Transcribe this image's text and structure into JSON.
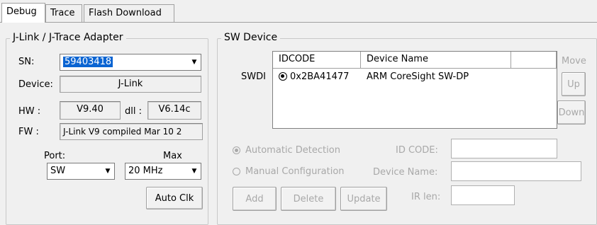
{
  "tabs": [
    "Debug",
    "Trace",
    "Flash Download"
  ],
  "adapter": {
    "title": "J-Link / J-Trace Adapter",
    "sn_label": "SN:",
    "sn_value": "59403418",
    "device_label": "Device:",
    "device_value": "J-Link",
    "hw_label": "HW :",
    "hw_value": "V9.40",
    "dll_label": "dll :",
    "dll_value": "V6.14c",
    "fw_label": "FW :",
    "fw_value": "J-Link V9 compiled Mar 10 2",
    "port_label": "Port:",
    "port_value": "SW",
    "max_label": "Max",
    "max_value": "20 MHz",
    "auto_clk": "Auto Clk"
  },
  "sw_device": {
    "title": "SW Device",
    "row_label": "SWDI",
    "columns": [
      "IDCODE",
      "Device Name"
    ],
    "rows": [
      {
        "idcode": "0x2BA41477",
        "name": "ARM CoreSight SW-DP"
      }
    ],
    "move_label": "Move",
    "up": "Up",
    "down": "Down",
    "auto_detect": "Automatic Detection",
    "manual_config": "Manual Configuration",
    "id_code_label": "ID CODE:",
    "device_name_label": "Device Name:",
    "ir_len_label": "IR len:",
    "add": "Add",
    "delete": "Delete",
    "update": "Update"
  }
}
